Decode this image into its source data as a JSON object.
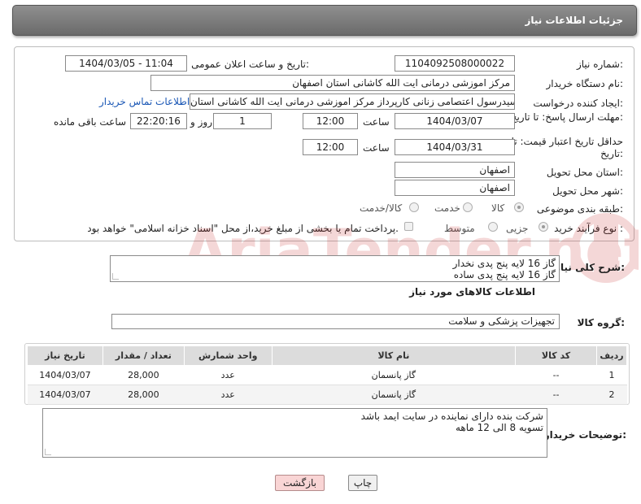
{
  "header": {
    "title": "جزئیات اطلاعات نیاز"
  },
  "form": {
    "need_number_label": "شماره نیاز:",
    "need_number": "1104092508000022",
    "announce_label": "تاریخ و ساعت اعلان عمومی:",
    "announce_value": "1404/03/05 - 11:04",
    "buyer_org_label": "نام دستگاه خریدار:",
    "buyer_org": "مرکز اموزشی درمانی ایت الله کاشانی استان اصفهان",
    "creator_label": "ایجاد کننده درخواست:",
    "creator": "سیدرسول اعتصامی زنانی کارپرداز مرکز اموزشی درمانی ایت الله کاشانی استان",
    "contact_link": "اطلاعات تماس خریدار",
    "deadline_label": "مهلت ارسال پاسخ: تا تاریخ:",
    "deadline_date": "1404/03/07",
    "time_label": "ساعت",
    "deadline_time": "12:00",
    "days_value": "1",
    "days_label": "روز و",
    "remaining_time": "22:20:16",
    "remaining_label": "ساعت باقی مانده",
    "price_validity_label": "حداقل تاریخ اعتبار قیمت: تا تاریخ:",
    "price_date": "1404/03/31",
    "price_time_label": "ساعت",
    "price_time": "12:00",
    "province_label": "استان محل تحویل:",
    "province": "اصفهان",
    "city_label": "شهر محل تحویل:",
    "city": "اصفهان",
    "category_label": "طبقه بندی موضوعی:",
    "category_options": [
      "کالا",
      "خدمت",
      "کالا/خدمت"
    ],
    "category_selected": "کالا",
    "process_label": "نوع فرآیند خرید :",
    "process_options": [
      "جزیی",
      "متوسط"
    ],
    "process_selected": "جزیی",
    "payment_note": "پرداخت تمام یا بخشی از مبلغ خرید،از محل \"اسناد خزانه اسلامی\" خواهد بود."
  },
  "description": {
    "label": "شرح کلی نیاز:",
    "lines": [
      "گاز 16 لایه پنج پدی نخدار",
      "گاز 16 لایه پنج پدی ساده"
    ]
  },
  "goods": {
    "section_title": "اطلاعات کالاهای مورد نیاز",
    "group_label": "گروه کالا:",
    "group_value": "تجهیزات پزشکی و سلامت",
    "columns": [
      "ردیف",
      "کد کالا",
      "نام کالا",
      "واحد شمارش",
      "تعداد / مقدار",
      "تاریخ نیاز"
    ],
    "rows": [
      {
        "index": "1",
        "code": "--",
        "name": "گاز پانسمان",
        "unit": "عدد",
        "qty": "28,000",
        "date": "1404/03/07"
      },
      {
        "index": "2",
        "code": "--",
        "name": "گاز پانسمان",
        "unit": "عدد",
        "qty": "28,000",
        "date": "1404/03/07"
      }
    ]
  },
  "buyer_notes": {
    "label": "توضیحات خریدار:",
    "lines": [
      "شرکت بنده دارای نماینده در سایت ایمد باشد",
      "تسویه  8 الی 12 ماهه"
    ]
  },
  "buttons": {
    "print": "چاپ",
    "back": "بازگشت"
  },
  "watermark": {
    "text": "AriaTender.net"
  }
}
